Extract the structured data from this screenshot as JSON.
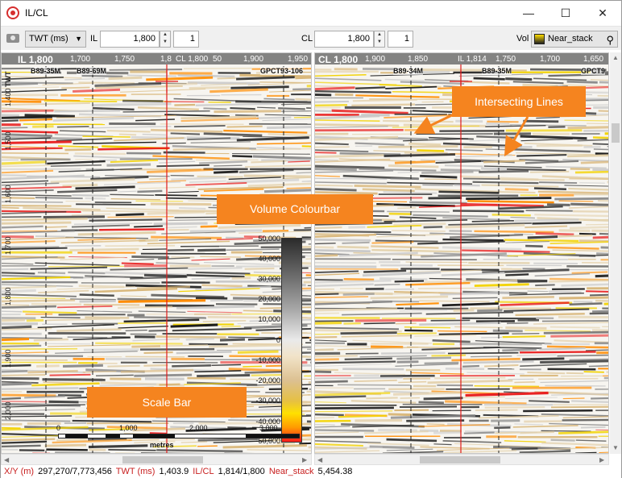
{
  "window": {
    "title": "IL/CL",
    "minimize": "—",
    "maximize": "☐",
    "close": "✕"
  },
  "toolbar": {
    "axis_select": "TWT (ms)",
    "il_label": "IL",
    "il_value": "1,800",
    "il_step": "1",
    "cl_label": "CL",
    "cl_value": "1,800",
    "cl_step": "1",
    "vol_label": "Vol",
    "vol_value": "Near_stack"
  },
  "left_panel": {
    "title": "IL 1,800",
    "ticks": [
      "1,700",
      "1,750",
      "1,8",
      "1,900",
      "1,950"
    ],
    "intersect_label": "CL 1,800",
    "intersect_tail": "50",
    "wells": [
      "B89-35M",
      "B89-69M",
      "GPCT93-106"
    ],
    "y_ticks": [
      "1,400",
      "1,500",
      "1,600",
      "1,700",
      "1,800",
      "1,900",
      "2,000"
    ],
    "y_top_label": "TWT"
  },
  "right_panel": {
    "title": "CL 1,800",
    "ticks": [
      "1,900",
      "1,850",
      "1,750",
      "1,700",
      "1,650"
    ],
    "intersect_label": "IL 1,814",
    "wells": [
      "B89-34M",
      "B89-35M",
      "GPCT9"
    ]
  },
  "colourbar": {
    "ticks": [
      "50,000",
      "40,000",
      "30,000",
      "20,000",
      "10,000",
      "0",
      "-10,000",
      "-20,000",
      "-30,000",
      "-40,000",
      "-50,000"
    ]
  },
  "scalebar": {
    "ticks": [
      "0",
      "1,000",
      "2,000",
      "3,000"
    ],
    "unit": "metres"
  },
  "callouts": {
    "colourbar": "Volume Colourbar",
    "scalebar": "Scale Bar",
    "intersecting": "Intersecting Lines"
  },
  "status": {
    "xy_label": "X/Y (m)",
    "xy_value": "297,270/7,773,456",
    "twt_label": "TWT (ms)",
    "twt_value": "1,403.9",
    "ilcl_label": "IL/CL",
    "ilcl_value": "1,814/1,800",
    "vol_label": "Near_stack",
    "vol_value": "5,454.38"
  },
  "colors": {
    "accent_orange": "#f5841f",
    "cursor_red": "#e01b1b",
    "status_key_red": "#c81e1e"
  }
}
